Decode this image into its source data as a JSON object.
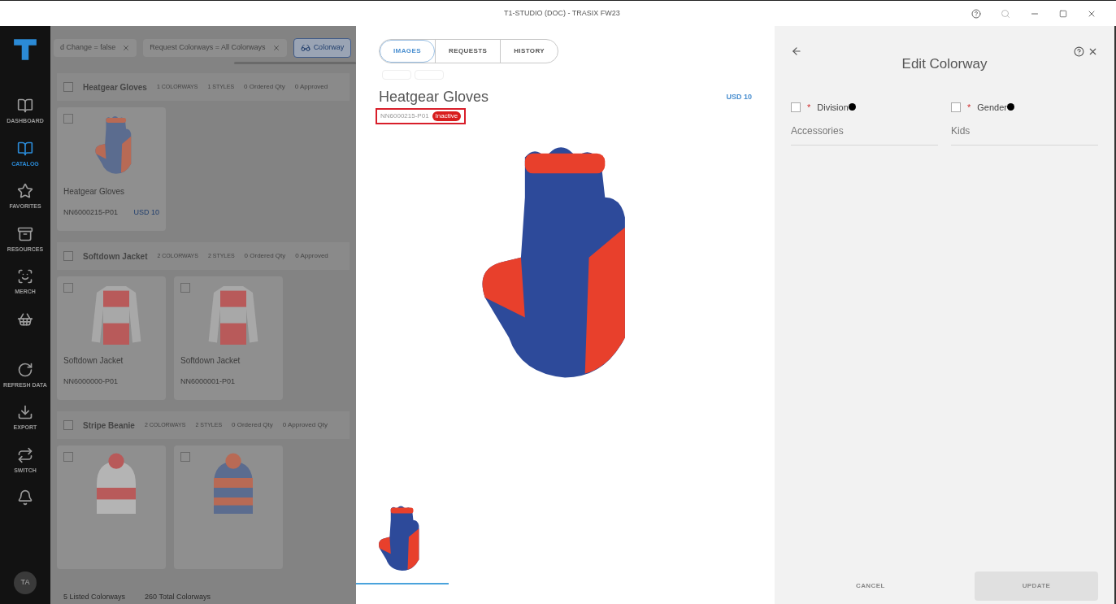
{
  "window": {
    "title": "T1-STUDIO (DOC) - TRASIX FW23"
  },
  "sidebar": {
    "items": [
      {
        "label": "DASHBOARD",
        "selected": false
      },
      {
        "label": "CATALOG",
        "selected": true
      },
      {
        "label": "FAVORITES",
        "selected": false
      },
      {
        "label": "RESOURCES",
        "selected": false
      },
      {
        "label": "MERCH",
        "selected": false
      },
      {
        "selected": false
      },
      {
        "label": "REFRESH DATA",
        "selected": false
      },
      {
        "label": "EXPORT",
        "selected": false
      },
      {
        "label": "SWITCH",
        "selected": false
      },
      {
        "selected": false
      }
    ],
    "avatar": "TA"
  },
  "catalog": {
    "filters": [
      "d Change = false",
      "Request Colorways = All Colorways"
    ],
    "colorway_button": "Colorway",
    "groups": [
      {
        "name": "Heatgear Gloves",
        "checked": false,
        "colorways": "1 COLORWAYS",
        "styles": "1 STYLES",
        "ordered": "0 Ordered Qty",
        "approved": "0 Approved",
        "cards": [
          {
            "kind": "glove",
            "checked": false,
            "name": "Heatgear Gloves",
            "code": "NN6000215-P01",
            "price": "USD 10"
          }
        ]
      },
      {
        "name": "Softdown Jacket",
        "checked": false,
        "colorways": "2 COLORWAYS",
        "styles": "2 STYLES",
        "ordered": "0 Ordered Qty",
        "approved": "0 Approved",
        "cards": [
          {
            "kind": "jacket",
            "checked": false,
            "name": "Softdown Jacket",
            "code": "NN6000000-P01"
          },
          {
            "kind": "jacket",
            "checked": false,
            "name": "Softdown Jacket",
            "code": "NN6000001-P01"
          }
        ]
      },
      {
        "name": "Stripe Beanie",
        "checked": false,
        "colorways": "2 COLORWAYS",
        "styles": "2 STYLES",
        "ordered": "0 Ordered Qty",
        "approved": "0 Approved Qty",
        "cards": [
          {
            "kind": "beanie",
            "checked": false
          },
          {
            "kind": "beanie-striped",
            "checked": false
          }
        ]
      }
    ],
    "status": [
      "5 Listed Colorways",
      "260 Total Colorways"
    ]
  },
  "detail": {
    "tabs": [
      {
        "label": "IMAGES",
        "selected": true
      },
      {
        "label": "REQUESTS",
        "selected": false
      },
      {
        "label": "HISTORY",
        "selected": false
      }
    ],
    "title": "Heatgear Gloves",
    "price": "USD 10",
    "code": "NN6000215-P01",
    "badge": "Inactive",
    "thumbnails": [
      {
        "selected": true
      }
    ]
  },
  "form": {
    "title": "Edit Colorway",
    "fields": [
      {
        "label": "Division",
        "marker": "*",
        "checked": false,
        "value": "Accessories"
      },
      {
        "label": "Gender",
        "marker": "*",
        "checked": false,
        "value": "Kids"
      }
    ],
    "cancel": "CANCEL",
    "update": {
      "label": "UPDATE",
      "disabled": true
    }
  }
}
